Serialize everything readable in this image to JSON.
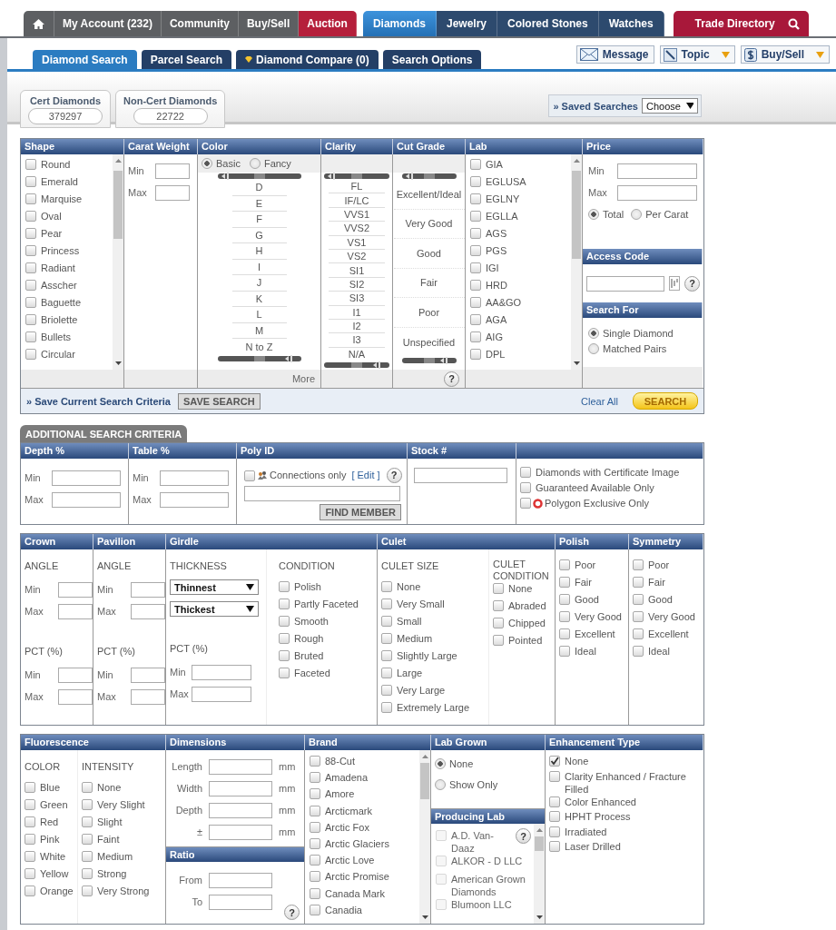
{
  "top_nav": [
    {
      "kind": "home",
      "selected": false
    },
    {
      "kind": "link",
      "label": "My Account (232)",
      "selected": false
    },
    {
      "kind": "link",
      "label": "Community",
      "selected": false
    },
    {
      "kind": "link",
      "label": "Buy/Sell",
      "selected": false
    },
    {
      "kind": "promo",
      "label": "Auction",
      "selected": false
    }
  ],
  "catalog_nav": [
    {
      "label": "Diamonds",
      "selected": true
    },
    {
      "label": "Jewelry",
      "selected": false
    },
    {
      "label": "Colored Stones",
      "selected": false
    },
    {
      "label": "Watches",
      "selected": false
    }
  ],
  "trade_directory": {
    "label": "Trade Directory"
  },
  "sub_tabs": [
    {
      "label": "Diamond Search",
      "selected": true,
      "kind": "plain"
    },
    {
      "label": "Parcel Search",
      "selected": false,
      "kind": "plain"
    },
    {
      "label": "Diamond Compare (0)",
      "selected": false,
      "kind": "compare"
    },
    {
      "label": "Search Options",
      "selected": false,
      "kind": "plain"
    }
  ],
  "tools": [
    {
      "label": "Message",
      "kind": "message",
      "dropdown": false
    },
    {
      "label": "Topic",
      "kind": "topic",
      "dropdown": true
    },
    {
      "label": "Buy/Sell",
      "kind": "dollar",
      "dropdown": true
    }
  ],
  "counts": [
    {
      "label": "Cert Diamonds",
      "value": "379297"
    },
    {
      "label": "Non-Cert Diamonds",
      "value": "22722"
    }
  ],
  "saved_searches": {
    "label": "» Saved Searches",
    "value": "Choose"
  },
  "search": {
    "shape": {
      "title": "Shape",
      "items": [
        {
          "label": "Round",
          "checked": false
        },
        {
          "label": "Emerald",
          "checked": false
        },
        {
          "label": "Marquise",
          "checked": false
        },
        {
          "label": "Oval",
          "checked": false
        },
        {
          "label": "Pear",
          "checked": false
        },
        {
          "label": "Princess",
          "checked": false
        },
        {
          "label": "Radiant",
          "checked": false
        },
        {
          "label": "Asscher",
          "checked": false
        },
        {
          "label": "Baguette",
          "checked": false
        },
        {
          "label": "Briolette",
          "checked": false
        },
        {
          "label": "Bullets",
          "checked": false
        },
        {
          "label": "Circular",
          "checked": false
        }
      ]
    },
    "carat": {
      "title": "Carat Weight",
      "min": "Min",
      "max": "Max"
    },
    "color": {
      "title": "Color",
      "modes": [
        {
          "label": "Basic",
          "selected": true
        },
        {
          "label": "Fancy",
          "selected": false
        }
      ],
      "grades": [
        "D",
        "E",
        "F",
        "G",
        "H",
        "I",
        "J",
        "K",
        "L",
        "M",
        "N to Z"
      ],
      "more": "More"
    },
    "clarity": {
      "title": "Clarity",
      "grades": [
        "FL",
        "IF/LC",
        "VVS1",
        "VVS2",
        "VS1",
        "VS2",
        "SI1",
        "SI2",
        "SI3",
        "I1",
        "I2",
        "I3",
        "N/A"
      ]
    },
    "cut": {
      "title": "Cut Grade",
      "grades": [
        "Excellent/Ideal",
        "Very Good",
        "Good",
        "Fair",
        "Poor",
        "Unspecified"
      ],
      "help": "?"
    },
    "lab": {
      "title": "Lab",
      "items": [
        {
          "label": "GIA",
          "checked": false
        },
        {
          "label": "EGLUSA",
          "checked": false
        },
        {
          "label": "EGLNY",
          "checked": false
        },
        {
          "label": "EGLLA",
          "checked": false
        },
        {
          "label": "AGS",
          "checked": false
        },
        {
          "label": "PGS",
          "checked": false
        },
        {
          "label": "IGI",
          "checked": false
        },
        {
          "label": "HRD",
          "checked": false
        },
        {
          "label": "AA&GO",
          "checked": false
        },
        {
          "label": "AGA",
          "checked": false
        },
        {
          "label": "AIG",
          "checked": false
        },
        {
          "label": "DPL",
          "checked": false
        }
      ]
    },
    "price": {
      "title": "Price",
      "min": "Min",
      "max": "Max",
      "basis": [
        {
          "label": "Total",
          "selected": true
        },
        {
          "label": "Per Carat",
          "selected": false
        }
      ]
    },
    "access_code": {
      "title": "Access Code",
      "help": "?"
    },
    "search_for": {
      "title": "Search For",
      "options": [
        {
          "label": "Single Diamond",
          "selected": true
        },
        {
          "label": "Matched Pairs",
          "selected": false
        }
      ]
    },
    "footer": {
      "save_label": "» Save Current Search Criteria",
      "save_button": "SAVE SEARCH",
      "clear": "Clear All",
      "search_button": "SEARCH"
    }
  },
  "additional": {
    "title": "ADDITIONAL SEARCH CRITERIA",
    "depth": {
      "title": "Depth %",
      "min": "Min",
      "max": "Max"
    },
    "table": {
      "title": "Table %",
      "min": "Min",
      "max": "Max"
    },
    "poly_id": {
      "title": "Poly ID",
      "connections_only": {
        "label": "Connections only",
        "checked": false
      },
      "edit": "[ Edit ]",
      "help": "?",
      "find_button": "FIND MEMBER"
    },
    "stock": {
      "title": "Stock #"
    },
    "flags": [
      {
        "label": "Diamonds with Certificate Image",
        "checked": false,
        "kind": "plain"
      },
      {
        "label": "Guaranteed Available Only",
        "checked": false,
        "kind": "plain"
      },
      {
        "label": "Polygon Exclusive Only",
        "checked": false,
        "kind": "exclusive"
      }
    ],
    "crown": {
      "title": "Crown",
      "angle": "ANGLE",
      "angle_min": "Min",
      "angle_max": "Max",
      "pct": "PCT (%)",
      "pct_min": "Min",
      "pct_max": "Max"
    },
    "pavilion": {
      "title": "Pavilion",
      "angle": "ANGLE",
      "angle_min": "Min",
      "angle_max": "Max",
      "pct": "PCT (%)",
      "pct_min": "Min",
      "pct_max": "Max"
    },
    "girdle": {
      "title": "Girdle",
      "thickness": "THICKNESS",
      "selects": [
        "Thinnest",
        "Thickest"
      ],
      "pct": "PCT (%)",
      "pct_min": "Min",
      "pct_max": "Max",
      "condition": "CONDITION",
      "conditions": [
        {
          "label": "Polish",
          "checked": false
        },
        {
          "label": "Partly Faceted",
          "checked": false
        },
        {
          "label": "Smooth",
          "checked": false
        },
        {
          "label": "Rough",
          "checked": false
        },
        {
          "label": "Bruted",
          "checked": false
        },
        {
          "label": "Faceted",
          "checked": false
        }
      ]
    },
    "culet": {
      "title": "Culet",
      "size": "CULET SIZE",
      "sizes": [
        {
          "label": "None",
          "checked": false
        },
        {
          "label": "Very Small",
          "checked": false
        },
        {
          "label": "Small",
          "checked": false
        },
        {
          "label": "Medium",
          "checked": false
        },
        {
          "label": "Slightly Large",
          "checked": false
        },
        {
          "label": "Large",
          "checked": false
        },
        {
          "label": "Very Large",
          "checked": false
        },
        {
          "label": "Extremely Large",
          "checked": false
        }
      ],
      "condition": "CULET CONDITION",
      "conditions": [
        {
          "label": "None",
          "checked": false
        },
        {
          "label": "Abraded",
          "checked": false
        },
        {
          "label": "Chipped",
          "checked": false
        },
        {
          "label": "Pointed",
          "checked": false
        }
      ]
    },
    "polish": {
      "title": "Polish",
      "items": [
        {
          "label": "Poor",
          "checked": false
        },
        {
          "label": "Fair",
          "checked": false
        },
        {
          "label": "Good",
          "checked": false
        },
        {
          "label": "Very Good",
          "checked": false
        },
        {
          "label": "Excellent",
          "checked": false
        },
        {
          "label": "Ideal",
          "checked": false
        }
      ]
    },
    "symmetry": {
      "title": "Symmetry",
      "items": [
        {
          "label": "Poor",
          "checked": false
        },
        {
          "label": "Fair",
          "checked": false
        },
        {
          "label": "Good",
          "checked": false
        },
        {
          "label": "Very Good",
          "checked": false
        },
        {
          "label": "Excellent",
          "checked": false
        },
        {
          "label": "Ideal",
          "checked": false
        }
      ]
    },
    "fluorescence": {
      "title": "Fluorescence",
      "color_heading": "COLOR",
      "colors": [
        {
          "label": "Blue",
          "checked": false
        },
        {
          "label": "Green",
          "checked": false
        },
        {
          "label": "Red",
          "checked": false
        },
        {
          "label": "Pink",
          "checked": false
        },
        {
          "label": "White",
          "checked": false
        },
        {
          "label": "Yellow",
          "checked": false
        },
        {
          "label": "Orange",
          "checked": false
        }
      ],
      "intensity_heading": "INTENSITY",
      "intensities": [
        {
          "label": "None",
          "checked": false
        },
        {
          "label": "Very Slight",
          "checked": false
        },
        {
          "label": "Slight",
          "checked": false
        },
        {
          "label": "Faint",
          "checked": false
        },
        {
          "label": "Medium",
          "checked": false
        },
        {
          "label": "Strong",
          "checked": false
        },
        {
          "label": "Very Strong",
          "checked": false
        }
      ]
    },
    "dimensions": {
      "title": "Dimensions",
      "fields": [
        {
          "label": "Length",
          "unit": "mm"
        },
        {
          "label": "Width",
          "unit": "mm"
        },
        {
          "label": "Depth",
          "unit": "mm"
        },
        {
          "label": "±",
          "unit": "mm"
        }
      ]
    },
    "ratio": {
      "title": "Ratio",
      "from": "From",
      "to": "To",
      "help": "?"
    },
    "brand": {
      "title": "Brand",
      "items": [
        {
          "label": "88-Cut",
          "checked": false
        },
        {
          "label": "Amadena",
          "checked": false
        },
        {
          "label": "Amore",
          "checked": false
        },
        {
          "label": "Arcticmark",
          "checked": false
        },
        {
          "label": "Arctic Fox",
          "checked": false
        },
        {
          "label": "Arctic Glaciers",
          "checked": false
        },
        {
          "label": "Arctic Love",
          "checked": false
        },
        {
          "label": "Arctic Promise",
          "checked": false
        },
        {
          "label": "Canada Mark",
          "checked": false
        },
        {
          "label": "Canadia",
          "checked": false
        }
      ]
    },
    "lab_grown": {
      "title": "Lab Grown",
      "options": [
        {
          "label": "None",
          "selected": true
        },
        {
          "label": "Show Only",
          "selected": false
        }
      ]
    },
    "producing_lab": {
      "title": "Producing Lab",
      "help": "?",
      "items": [
        {
          "label": "A.D. Van-Daaz",
          "checked": false,
          "disabled": true
        },
        {
          "label": "ALKOR - D LLC",
          "checked": false,
          "disabled": true
        },
        {
          "label": "American Grown Diamonds",
          "checked": false,
          "disabled": true
        },
        {
          "label": "Blumoon LLC",
          "checked": false,
          "disabled": true
        }
      ]
    },
    "enhancement": {
      "title": "Enhancement Type",
      "items": [
        {
          "label": "None",
          "checked": true
        },
        {
          "label": "Clarity Enhanced / Fracture Filled",
          "checked": false
        },
        {
          "label": "Color Enhanced",
          "checked": false
        },
        {
          "label": "HPHT Process",
          "checked": false
        },
        {
          "label": "Irradiated",
          "checked": false
        },
        {
          "label": "Laser Drilled",
          "checked": false
        }
      ]
    }
  }
}
